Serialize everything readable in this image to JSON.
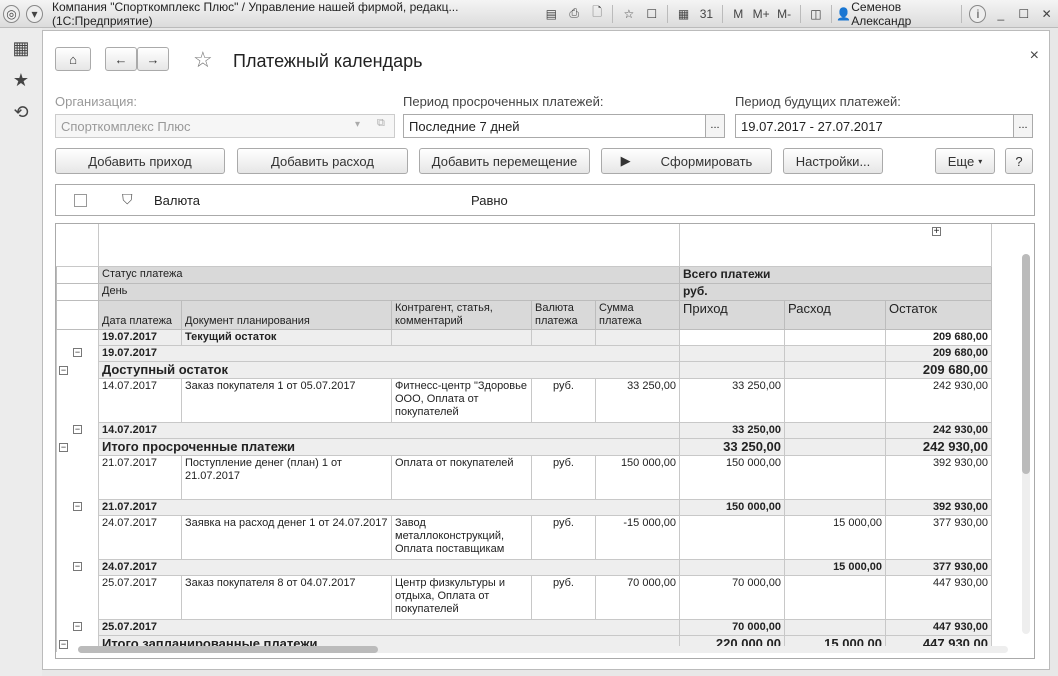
{
  "titlebar": {
    "title": "Компания \"Спорткомплекс Плюс\" / Управление нашей фирмой, редакц... (1С:Предприятие)",
    "m": "M",
    "mplus": "M+",
    "mminus": "M-",
    "user": "Семенов Александр"
  },
  "form": {
    "title": "Платежный календарь",
    "org_label": "Организация:",
    "org_value": "Спорткомплекс Плюс",
    "overdue_label": "Период просроченных платежей:",
    "overdue_value": "Последние 7 дней",
    "future_label": "Период будущих платежей:",
    "future_value": "19.07.2017 - 27.07.2017",
    "dots": "...",
    "buttons": {
      "add_income": "Добавить приход",
      "add_expense": "Добавить расход",
      "add_transfer": "Добавить перемещение",
      "generate": "Сформировать",
      "settings": "Настройки...",
      "more": "Еще",
      "help": "?"
    },
    "filter": {
      "field": "Валюта",
      "condition": "Равно"
    }
  },
  "report": {
    "hdr": {
      "status": "Статус платежа",
      "day": "День",
      "date": "Дата платежа",
      "doc": "Документ планирования",
      "contr": "Контрагент, статья, комментарий",
      "cur": "Валюта платежа",
      "sum": "Сумма платежа",
      "all": "Всего платежи",
      "rub": "руб.",
      "in": "Приход",
      "out": "Расход",
      "bal": "Остаток"
    },
    "rows": [
      {
        "t": "cur",
        "date": "19.07.2017",
        "doc": "Текущий остаток",
        "contr": "",
        "cur": "",
        "sum": "",
        "in": "",
        "out": "",
        "bal": "209 680,00"
      },
      {
        "t": "day",
        "date": "19.07.2017",
        "in": "",
        "out": "",
        "bal": "209 680,00"
      },
      {
        "t": "tot",
        "label": "Доступный остаток",
        "in": "",
        "out": "",
        "bal": "209 680,00"
      },
      {
        "t": "det",
        "date": "14.07.2017",
        "doc": "Заказ покупателя 1 от 05.07.2017",
        "contr": "Фитнесс-центр \"Здоровье ООО, Оплата от покупателей",
        "cur": "руб.",
        "sum": "33 250,00",
        "in": "33 250,00",
        "out": "",
        "bal": "242 930,00"
      },
      {
        "t": "day",
        "date": "14.07.2017",
        "in": "33 250,00",
        "out": "",
        "bal": "242 930,00"
      },
      {
        "t": "tot",
        "label": "Итого просроченные платежи",
        "in": "33 250,00",
        "out": "",
        "bal": "242 930,00"
      },
      {
        "t": "det",
        "date": "21.07.2017",
        "doc": "Поступление денег (план) 1 от 21.07.2017",
        "contr": "Оплата от покупателей",
        "cur": "руб.",
        "sum": "150 000,00",
        "in": "150 000,00",
        "out": "",
        "bal": "392 930,00"
      },
      {
        "t": "day",
        "date": "21.07.2017",
        "in": "150 000,00",
        "out": "",
        "bal": "392 930,00"
      },
      {
        "t": "det",
        "date": "24.07.2017",
        "doc": "Заявка на расход денег 1 от 24.07.2017",
        "contr": "Завод металлоконструкций, Оплата поставщикам",
        "cur": "руб.",
        "sum": "-15 000,00",
        "in": "",
        "out": "15 000,00",
        "bal": "377 930,00"
      },
      {
        "t": "day",
        "date": "24.07.2017",
        "in": "",
        "out": "15 000,00",
        "bal": "377 930,00"
      },
      {
        "t": "det",
        "date": "25.07.2017",
        "doc": "Заказ покупателя 8 от 04.07.2017",
        "contr": "Центр физкультуры и отдыха, Оплата от покупателей",
        "cur": "руб.",
        "sum": "70 000,00",
        "in": "70 000,00",
        "out": "",
        "bal": "447 930,00"
      },
      {
        "t": "day",
        "date": "25.07.2017",
        "in": "70 000,00",
        "out": "",
        "bal": "447 930,00"
      },
      {
        "t": "tot",
        "label": "Итого запланированные платежи",
        "in": "220 000,00",
        "out": "15 000,00",
        "bal": "447 930,00"
      }
    ]
  }
}
